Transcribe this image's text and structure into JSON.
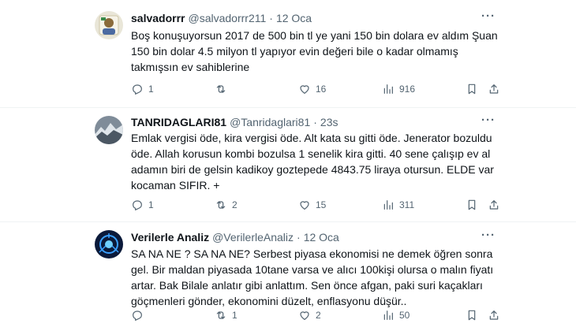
{
  "tweets": [
    {
      "name": "salvadorrr",
      "handle": "@salvadorrr211",
      "time": "12 Oca",
      "lines": [
        "Boş konuşuyorsun 2017 de 500 bin tl ye yani 150 bin dolara ev aldım Şuan",
        "150 bin dolar 4.5 milyon tl yapıyor evin değeri bile o kadar olmamış",
        "takmışsın ev sahiblerine"
      ],
      "replies": "1",
      "retweets": "",
      "likes": "16",
      "views": "916"
    },
    {
      "name": "TANRIDAGLARI81",
      "handle": "@Tanridaglari81",
      "time": "23s",
      "lines": [
        "Emlak vergisi öde, kira vergisi öde. Alt kata su gitti öde. Jenerator bozuldu",
        "öde. Allah korusun kombi bozulsa 1 senelik kira gitti. 40 sene çalışıp ev al",
        "adamın biri de gelsin kadikoy goztepede 4843.75 liraya otursun. ELDE var",
        "kocaman SIFIR. +"
      ],
      "replies": "1",
      "retweets": "2",
      "likes": "15",
      "views": "311"
    },
    {
      "name": "Verilerle Analiz",
      "handle": "@VerilerleAnaliz",
      "time": "12 Oca",
      "lines": [
        "SA NA NE ? SA NA NE? Serbest piyasa ekonomisi ne demek öğren sonra",
        "gel. Bir maldan piyasada 10tane varsa ve alıcı 100kişi olursa o malın fiyatı",
        "artar. Bak Bilale anlatır gibi anlattım. Sen önce afgan, paki suri kaçakları",
        "göçmenleri gönder, ekonomini düzelt, enflasyonu düşür.."
      ],
      "replies": "",
      "retweets": "1",
      "likes": "2",
      "views": "50"
    }
  ],
  "colors": {
    "text_primary": "#0f1419",
    "text_secondary": "#536471",
    "divider": "#eff3f4"
  }
}
